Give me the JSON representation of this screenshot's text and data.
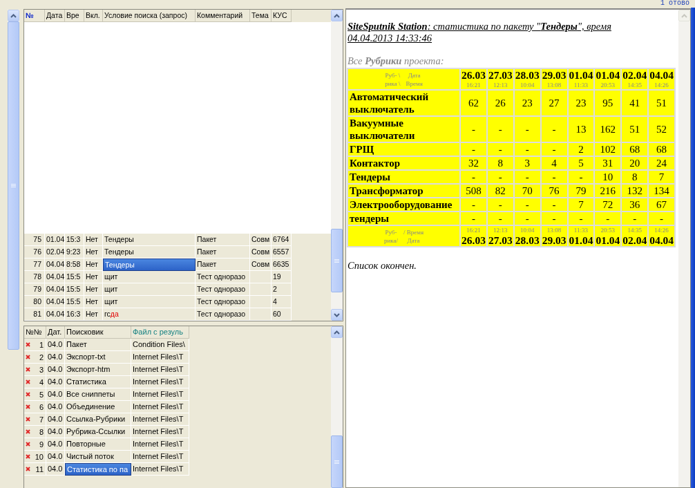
{
  "status_text": "1 отово",
  "queries": {
    "columns": [
      "№",
      "Дата",
      "Вре",
      "Вкл.",
      "Условие поиска (запрос)",
      "Комментарий",
      "Тема",
      "КУС"
    ],
    "rows": [
      {
        "number": "75",
        "date": "01.04",
        "time": "15:3",
        "enabled": "Нет",
        "query": [
          {
            "text": "Тендеры",
            "highlight": false
          }
        ],
        "comment": "Пакет",
        "topic": "Совм",
        "kus": "6764",
        "selected": false
      },
      {
        "number": "76",
        "date": "02.04",
        "time": "9:23",
        "enabled": "Нет",
        "query": [
          {
            "text": "Тендеры",
            "highlight": false
          }
        ],
        "comment": "Пакет",
        "topic": "Совм",
        "kus": "6557",
        "selected": false
      },
      {
        "number": "77",
        "date": "04.04",
        "time": "8:58",
        "enabled": "Нет",
        "query": [
          {
            "text": "Тендеры",
            "highlight": false
          }
        ],
        "comment": "Пакет",
        "topic": "Совм",
        "kus": "6635",
        "selected": true
      },
      {
        "number": "78",
        "date": "04.04",
        "time": "15:5",
        "enabled": "Нет",
        "query": [
          {
            "text": "щит",
            "highlight": false
          }
        ],
        "comment": "Тест одноразо",
        "kus": "19",
        "selected": false
      },
      {
        "number": "79",
        "date": "04.04",
        "time": "15:5",
        "enabled": "Нет",
        "query": [
          {
            "text": "щит",
            "highlight": false
          }
        ],
        "comment": "Тест одноразо",
        "kus": "2",
        "selected": false
      },
      {
        "number": "80",
        "date": "04.04",
        "time": "15:5",
        "enabled": "Нет",
        "query": [
          {
            "text": "щит",
            "highlight": false
          }
        ],
        "comment": "Тест одноразо",
        "kus": "4",
        "selected": false
      },
      {
        "number": "81",
        "date": "04.04",
        "time": "16:3",
        "enabled": "Нет",
        "query": [
          {
            "text": "гс",
            "highlight": false
          },
          {
            "text": "да",
            "highlight": true
          }
        ],
        "comment": "Тест одноразо",
        "kus": "60",
        "selected": false
      }
    ]
  },
  "results": {
    "columns": [
      {
        "label": "№№",
        "sorted": false
      },
      {
        "label": "Дат.",
        "sorted": false
      },
      {
        "label": "Поисковик",
        "sorted": false
      },
      {
        "label": "Файл с резуль",
        "sorted": true
      }
    ],
    "rows": [
      {
        "number": "1",
        "date": "04.0",
        "engine": "Пакет",
        "file": "Condition Files\\",
        "error": true,
        "selected": false
      },
      {
        "number": "2",
        "date": "04.0",
        "engine": "Экспорт-txt",
        "file": "Internet Files\\T",
        "error": true,
        "selected": false
      },
      {
        "number": "3",
        "date": "04.0",
        "engine": "Экспорт-htm",
        "file": "Internet Files\\T",
        "error": true,
        "selected": false
      },
      {
        "number": "4",
        "date": "04.0",
        "engine": "Статистика",
        "file": "Internet Files\\T",
        "error": true,
        "selected": false
      },
      {
        "number": "5",
        "date": "04.0",
        "engine": "Все сниппеты",
        "file": "Internet Files\\T",
        "error": true,
        "selected": false
      },
      {
        "number": "6",
        "date": "04.0",
        "engine": "Объединение",
        "file": "Internet Files\\T",
        "error": true,
        "selected": false
      },
      {
        "number": "7",
        "date": "04.0",
        "engine": "Ссылка-Рубрики",
        "file": "Internet Files\\T",
        "error": true,
        "selected": false
      },
      {
        "number": "8",
        "date": "04.0",
        "engine": "Рубрика-Ссылки",
        "file": "Internet Files\\T",
        "error": true,
        "selected": false
      },
      {
        "number": "9",
        "date": "04.0",
        "engine": "Повторные",
        "file": "Internet Files\\T",
        "error": true,
        "selected": false
      },
      {
        "number": "10",
        "date": "04.0",
        "engine": "Чистый поток",
        "file": "Internet Files\\T",
        "error": true,
        "selected": false
      },
      {
        "number": "11",
        "date": "04.0",
        "engine": "Статистика по па",
        "file": "Internet Files\\T",
        "error": true,
        "selected": true
      }
    ]
  },
  "report": {
    "title": "**SiteSputnik Station**: статистика по пакету \"**Тендеры**\", время 04.04.2013 14:33:46",
    "subtitle": "Все **Рубрики** проекта:",
    "corner_top": [
      "Руб- \\",
      "Дата",
      "рика \\",
      "Время"
    ],
    "corner_bottom": [
      "Руб-",
      "/ Время",
      "рика/",
      "Дата"
    ],
    "columns": [
      {
        "date": "26.03",
        "time": "16:21"
      },
      {
        "date": "27.03",
        "time": "12:13"
      },
      {
        "date": "28.03",
        "time": "10:04"
      },
      {
        "date": "29.03",
        "time": "13:08"
      },
      {
        "date": "01.04",
        "time": "11:33"
      },
      {
        "date": "01.04",
        "time": "20:53"
      },
      {
        "date": "02.04",
        "time": "14:35"
      },
      {
        "date": "04.04",
        "time": "14:26"
      }
    ],
    "rows": [
      {
        "name": "Автоматический выключатель",
        "values": [
          "62",
          "26",
          "23",
          "27",
          "23",
          "95",
          "41",
          "51"
        ]
      },
      {
        "name": "Вакуумные выключатели",
        "values": [
          "-",
          "-",
          "-",
          "-",
          "13",
          "162",
          "51",
          "52"
        ]
      },
      {
        "name": "ГРЩ",
        "values": [
          "-",
          "-",
          "-",
          "-",
          "2",
          "102",
          "68",
          "68"
        ]
      },
      {
        "name": "Контактор",
        "values": [
          "32",
          "8",
          "3",
          "4",
          "5",
          "31",
          "20",
          "24"
        ]
      },
      {
        "name": "Тендеры",
        "values": [
          "-",
          "-",
          "-",
          "-",
          "-",
          "10",
          "8",
          "7"
        ]
      },
      {
        "name": "Трансформатор",
        "values": [
          "508",
          "82",
          "70",
          "76",
          "79",
          "216",
          "132",
          "134"
        ]
      },
      {
        "name": "Электрооборудование",
        "values": [
          "-",
          "-",
          "-",
          "-",
          "7",
          "72",
          "36",
          "67"
        ]
      },
      {
        "name": "тендеры",
        "values": [
          "-",
          "-",
          "-",
          "-",
          "-",
          "-",
          "-",
          "-"
        ]
      }
    ],
    "footer_columns": [
      {
        "date": "26.03",
        "time": "16:21"
      },
      {
        "date": "27.03",
        "time": "12:13"
      },
      {
        "date": "28.03",
        "time": "10:04"
      },
      {
        "date": "29.03",
        "time": "13:08"
      },
      {
        "date": "01.04",
        "time": "11:33"
      },
      {
        "date": "01.04",
        "time": "20:53"
      },
      {
        "date": "02.04",
        "time": "14:35"
      },
      {
        "date": "04.04",
        "time": "14:26"
      }
    ],
    "footer": "Список окончен."
  }
}
